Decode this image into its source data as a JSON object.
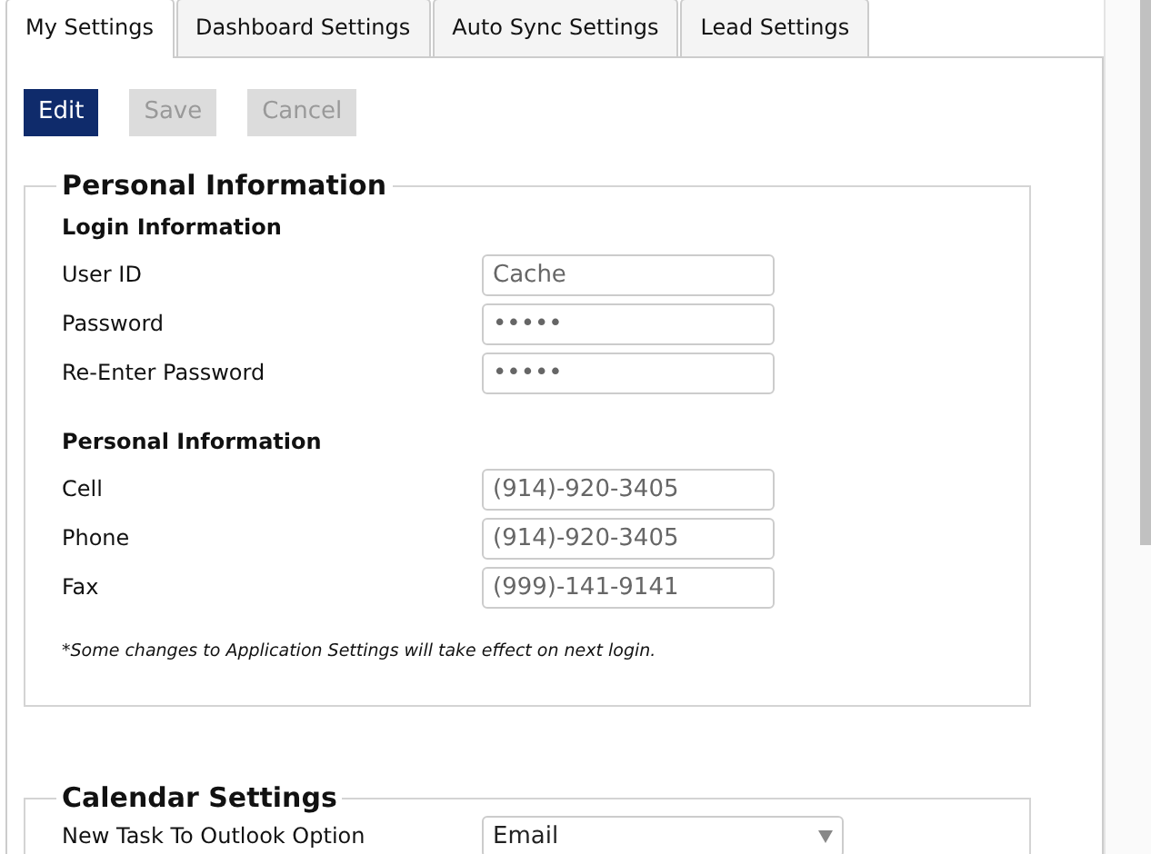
{
  "tabs": [
    {
      "label": "My Settings",
      "selected": true
    },
    {
      "label": "Dashboard Settings",
      "selected": false
    },
    {
      "label": "Auto Sync Settings",
      "selected": false
    },
    {
      "label": "Lead Settings",
      "selected": false
    }
  ],
  "buttons": [
    {
      "label": "Edit",
      "disabled": false
    },
    {
      "label": "Save",
      "disabled": true
    },
    {
      "label": "Cancel",
      "disabled": true
    }
  ],
  "sections": [
    {
      "legend": "Personal Information",
      "groups": [
        {
          "heading": "Login Information",
          "fields": [
            {
              "label": "User ID",
              "kind": "text",
              "value": "Cache",
              "disabled": true
            },
            {
              "label": "Password",
              "kind": "text",
              "value": "•••••",
              "disabled": true
            },
            {
              "label": "Re-Enter Password",
              "kind": "text",
              "value": "•••••",
              "disabled": true
            }
          ]
        },
        {
          "heading": "Personal Information",
          "fields": [
            {
              "label": "Cell",
              "kind": "text",
              "value": "(914)-920-3405",
              "disabled": true
            },
            {
              "label": "Phone",
              "kind": "text",
              "value": "(914)-920-3405",
              "disabled": true
            },
            {
              "label": "Fax",
              "kind": "text",
              "value": "(999)-141-9141",
              "disabled": true
            }
          ]
        }
      ],
      "note": "*Some changes to Application Settings will take effect on next login."
    },
    {
      "legend": "Calendar Settings",
      "groups": [
        {
          "fields": [
            {
              "label": "New Task To Outlook Option",
              "kind": "select",
              "value": "Email",
              "disabled": false
            }
          ]
        }
      ]
    }
  ]
}
